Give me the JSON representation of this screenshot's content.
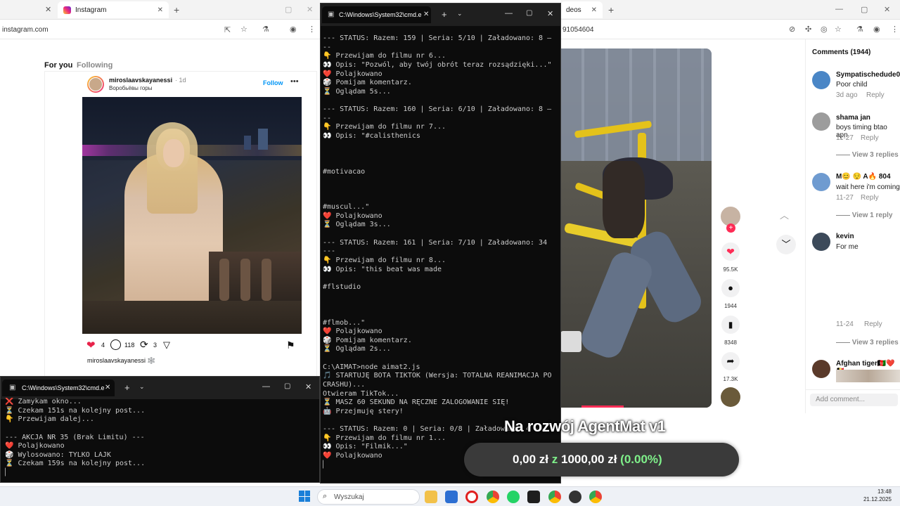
{
  "colors": {
    "heart_red": "#e8234a",
    "tiktok_pink": "#fe2c55",
    "money_green": "#7ff08a",
    "ig_blue": "#0095f6",
    "terminal_bg": "#0c0c0c"
  },
  "left_browser": {
    "tabs": [
      {
        "label": ""
      },
      {
        "label": "Instagram"
      }
    ],
    "address": "instagram.com",
    "ig_tabs": {
      "for_you": "For you",
      "following": "Following"
    },
    "post": {
      "username": "miroslaavskayanessi",
      "time": "· 1d",
      "location": "Воробьёвы горы",
      "follow_label": "Follow",
      "likes": "4",
      "comments": "118",
      "reposts": "3",
      "caption_user": "miroslaavskayanessi 🕸️"
    }
  },
  "center_terminal": {
    "title": "C:\\Windows\\System32\\cmd.e",
    "lines": [
      "--- STATUS: Razem: 159 | Seria: 5/10 | Załadowano: 8 –",
      "--",
      "👇 Przewijam do filmu nr 6...",
      "👀 Opis: \"Pozwól, aby twój obrót teraz rozsądzięki...\"",
      "❤️ Polajkowano",
      "🎲 Pomijam komentarz.",
      "⏳ Oglądam 5s...",
      "",
      "--- STATUS: Razem: 160 | Seria: 6/10 | Załadowano: 8 –",
      "--",
      "👇 Przewijam do filmu nr 7...",
      "👀 Opis: \"#calisthenics",
      "",
      "",
      "",
      "#motivacao",
      "",
      "",
      "",
      "#muscul...\"",
      "❤️ Polajkowano",
      "⏳ Oglądam 3s...",
      "",
      "--- STATUS: Razem: 161 | Seria: 7/10 | Załadowano: 34",
      "---",
      "👇 Przewijam do filmu nr 8...",
      "👀 Opis: \"this beat was made",
      "",
      "#flstudio",
      "",
      "",
      "",
      "#flmob...\"",
      "❤️ Polajkowano",
      "🎲 Pomijam komentarz.",
      "⏳ Oglądam 2s...",
      "",
      "C:\\AIMAT>node aimat2.js",
      "🎵 STARTUJĘ BOTA TIKTOK (Wersja: TOTALNA REANIMACJA PO",
      "CRASHU)...",
      "Otwieram TikTok...",
      "⏳ MASZ 60 SEKUND NA RĘCZNE ZALOGOWANIE SIĘ!",
      "🤖 Przejmuję stery!",
      "",
      "--- STATUS: Razem: 0 | Seria: 0/8 | Załadowano: 4 ---",
      "👇 Przewijam do filmu nr 1...",
      "👀 Opis: \"Filmik...\"",
      "❤️ Polajkowano",
      "▏"
    ]
  },
  "bottom_terminal": {
    "title": "C:\\Windows\\System32\\cmd.e",
    "lines": [
      "❌ Zamykam okno...",
      "⏳ Czekam 151s na kolejny post...",
      "👇 Przewijam dalej...",
      "",
      "--- AKCJA NR 35 (Brak Limitu) ---",
      "❤️ Polajkowano",
      "🎲 Wylosowano: TYLKO LAJK",
      "⏳ Czekam 159s na kolejny post...",
      "▏"
    ]
  },
  "right_browser": {
    "tab_label": "deos",
    "address_fragment": "91054604",
    "comments_header": "Comments (1944)",
    "actions": {
      "likes": "95.5K",
      "comments": "1944",
      "saves": "8348",
      "shares": "17.3K"
    },
    "comments": [
      {
        "user": "Sympatischedude0",
        "text": "Poor child",
        "meta": "3d ago",
        "reply": "Reply",
        "view_replies": ""
      },
      {
        "user": "shama jan",
        "text": "boys timing btao apn",
        "meta": "11-27",
        "reply": "Reply",
        "view_replies": "View 3 replies"
      },
      {
        "user": "M😊 😌 A🔥 804",
        "text": "wait here i'm coming",
        "meta": "11-27",
        "reply": "Reply",
        "view_replies": "View 1 reply"
      },
      {
        "user": "kevin",
        "text": "For me",
        "meta": "",
        "reply": "",
        "view_replies": ""
      },
      {
        "user": "",
        "text": "",
        "meta": "11-24",
        "reply": "Reply",
        "view_replies": "View 3 replies"
      },
      {
        "user": "Afghan tiger🇦🇫❤️🇧🇪",
        "text": "",
        "meta": "",
        "reply": "",
        "view_replies": ""
      }
    ],
    "add_comment_placeholder": "Add comment..."
  },
  "overlay": {
    "title": "Na rozwój AgentMat v1",
    "current": "0,00 zł",
    "of": "z",
    "goal": "1000,00 zł",
    "percent": "(0.00%)",
    "progress": 0.0
  },
  "taskbar": {
    "search_placeholder": "Wyszukaj",
    "time": "13:48",
    "date": "21.12.2025"
  }
}
